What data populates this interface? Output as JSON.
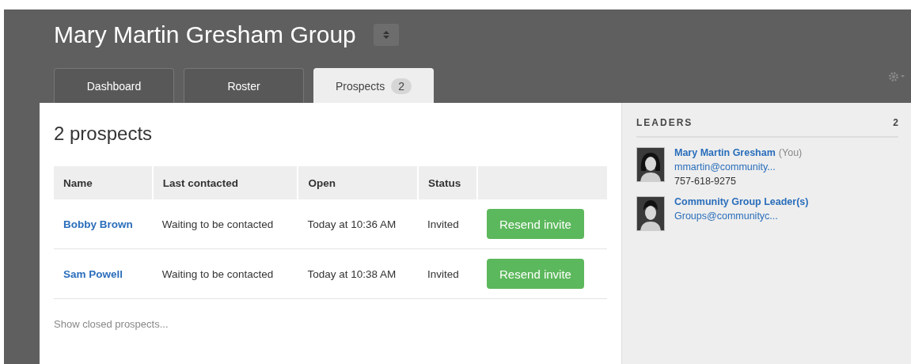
{
  "header": {
    "title": "Mary Martin Gresham Group"
  },
  "tabs": [
    {
      "label": "Dashboard",
      "selected": false
    },
    {
      "label": "Roster",
      "selected": false
    },
    {
      "label": "Prospects",
      "badge": "2",
      "selected": true
    }
  ],
  "main": {
    "heading": "2 prospects",
    "table": {
      "columns": [
        "Name",
        "Last contacted",
        "Open",
        "Status"
      ],
      "rows": [
        {
          "name": "Bobby Brown",
          "last_contacted": "Waiting to be contacted",
          "open": "Today at 10:36 AM",
          "status": "Invited",
          "action": "Resend invite"
        },
        {
          "name": "Sam Powell",
          "last_contacted": "Waiting to be contacted",
          "open": "Today at 10:38 AM",
          "status": "Invited",
          "action": "Resend invite"
        }
      ]
    },
    "footer_link": "Show closed prospects..."
  },
  "sidebar": {
    "heading": "LEADERS",
    "count": "2",
    "leaders": [
      {
        "name": "Mary Martin Gresham",
        "note": "(You)",
        "email": "mmartin@community...",
        "phone": "757-618-9275",
        "kind": "long"
      },
      {
        "name": "Community Group Leader(s)",
        "email": "Groups@communityc...",
        "kind": "short"
      }
    ]
  }
}
